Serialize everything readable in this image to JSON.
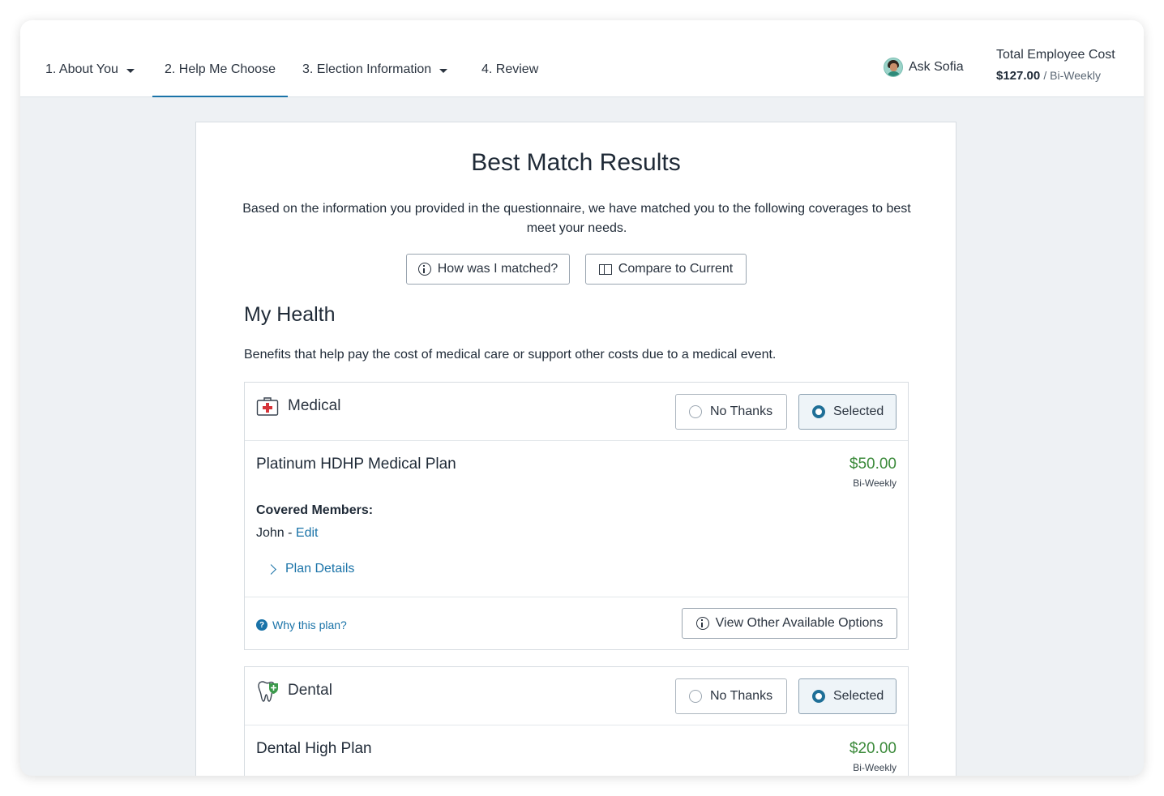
{
  "nav": {
    "tabs": [
      {
        "label": "1. About You",
        "has_dropdown": true,
        "active": false
      },
      {
        "label": "2. Help Me Choose",
        "has_dropdown": false,
        "active": true
      },
      {
        "label": "3. Election Information",
        "has_dropdown": true,
        "active": false
      },
      {
        "label": "4. Review",
        "has_dropdown": false,
        "active": false
      }
    ],
    "ask_label": "Ask Sofia",
    "cost": {
      "label": "Total Employee Cost",
      "amount": "$127.00",
      "period": "/ Bi-Weekly"
    }
  },
  "results": {
    "title": "Best Match Results",
    "intro": "Based on the information you provided in the questionnaire, we have matched you to the following coverages to best meet your needs.",
    "how_matched_label": "How was I matched?",
    "compare_label": "Compare to Current"
  },
  "section": {
    "title": "My Health",
    "description": "Benefits that help pay the cost of medical care or support other costs due to a medical event."
  },
  "benefits": [
    {
      "name": "Medical",
      "icon": "medical-kit-icon",
      "no_thanks_label": "No Thanks",
      "selected_label": "Selected",
      "selected": true,
      "plan_name": "Platinum HDHP Medical Plan",
      "price": "$50.00",
      "period": "Bi-Weekly",
      "covered_label": "Covered Members:",
      "member": "John",
      "member_separator": " - ",
      "edit_label": "Edit",
      "details_label": "Plan Details",
      "why_label": "Why this plan?",
      "other_options_label": "View Other Available Options"
    },
    {
      "name": "Dental",
      "icon": "tooth-shield-icon",
      "no_thanks_label": "No Thanks",
      "selected_label": "Selected",
      "selected": true,
      "plan_name": "Dental High Plan",
      "price": "$20.00",
      "period": "Bi-Weekly"
    }
  ],
  "colors": {
    "accent": "#1a73a8",
    "price": "#3b8a3a",
    "background": "#eef1f4"
  }
}
